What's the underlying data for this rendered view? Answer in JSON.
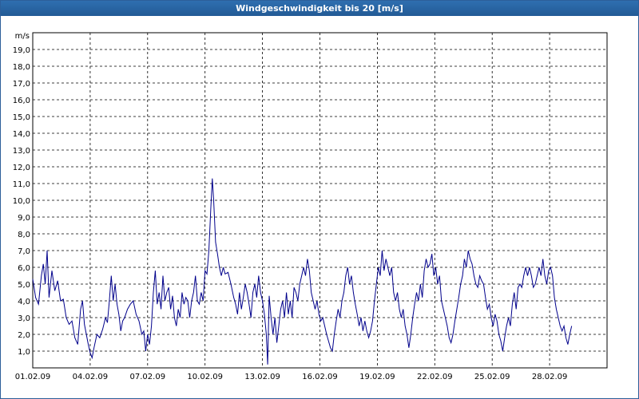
{
  "window": {
    "title": "Windgeschwindigkeit bis 20 [m/s]"
  },
  "chart_data": {
    "type": "line",
    "title": "Windgeschwindigkeit bis 20 [m/s]",
    "ylabel": "m/s",
    "xlabel": "",
    "ylim": [
      0,
      20
    ],
    "xlim_days": [
      0,
      30
    ],
    "grid": true,
    "line_color": "#00008b",
    "y_ticks": [
      "1,0",
      "2,0",
      "3,0",
      "4,0",
      "5,0",
      "6,0",
      "7,0",
      "8,0",
      "9,0",
      "10,0",
      "11,0",
      "12,0",
      "13,0",
      "14,0",
      "15,0",
      "16,0",
      "17,0",
      "18,0",
      "19,0"
    ],
    "x_ticks": [
      {
        "day": 0,
        "label": "01.02.09"
      },
      {
        "day": 3,
        "label": "04.02.09"
      },
      {
        "day": 6,
        "label": "07.02.09"
      },
      {
        "day": 9,
        "label": "10.02.09"
      },
      {
        "day": 12,
        "label": "13.02.09"
      },
      {
        "day": 15,
        "label": "16.02.09"
      },
      {
        "day": 18,
        "label": "19.02.09"
      },
      {
        "day": 21,
        "label": "22.02.09"
      },
      {
        "day": 24,
        "label": "25.02.09"
      },
      {
        "day": 27,
        "label": "28.02.09"
      }
    ],
    "series": [
      {
        "points": [
          [
            0,
            5.3
          ],
          [
            0.15,
            4.2
          ],
          [
            0.3,
            3.8
          ],
          [
            0.45,
            5.5
          ],
          [
            0.55,
            6.2
          ],
          [
            0.65,
            5.0
          ],
          [
            0.75,
            7.0
          ],
          [
            0.85,
            4.2
          ],
          [
            1.0,
            5.8
          ],
          [
            1.15,
            4.6
          ],
          [
            1.3,
            5.2
          ],
          [
            1.45,
            4.0
          ],
          [
            1.6,
            4.1
          ],
          [
            1.75,
            3.0
          ],
          [
            1.9,
            2.6
          ],
          [
            2.05,
            2.8
          ],
          [
            2.2,
            1.8
          ],
          [
            2.35,
            1.4
          ],
          [
            2.5,
            3.5
          ],
          [
            2.6,
            4.0
          ],
          [
            2.7,
            2.6
          ],
          [
            2.8,
            2.0
          ],
          [
            2.9,
            1.4
          ],
          [
            3.0,
            0.9
          ],
          [
            3.1,
            0.6
          ],
          [
            3.2,
            1.2
          ],
          [
            3.35,
            2.0
          ],
          [
            3.5,
            1.8
          ],
          [
            3.65,
            2.3
          ],
          [
            3.8,
            3.0
          ],
          [
            3.9,
            2.7
          ],
          [
            4.0,
            4.0
          ],
          [
            4.1,
            5.5
          ],
          [
            4.2,
            4.0
          ],
          [
            4.3,
            5.0
          ],
          [
            4.4,
            3.8
          ],
          [
            4.5,
            3.2
          ],
          [
            4.6,
            2.2
          ],
          [
            4.7,
            2.8
          ],
          [
            4.8,
            3.0
          ],
          [
            4.95,
            3.5
          ],
          [
            5.1,
            3.8
          ],
          [
            5.25,
            4.0
          ],
          [
            5.4,
            3.2
          ],
          [
            5.55,
            2.8
          ],
          [
            5.7,
            2.0
          ],
          [
            5.8,
            2.2
          ],
          [
            5.9,
            1.0
          ],
          [
            6.0,
            2.0
          ],
          [
            6.1,
            1.4
          ],
          [
            6.2,
            2.5
          ],
          [
            6.3,
            4.5
          ],
          [
            6.4,
            5.8
          ],
          [
            6.5,
            3.8
          ],
          [
            6.6,
            4.5
          ],
          [
            6.7,
            3.5
          ],
          [
            6.8,
            5.5
          ],
          [
            6.9,
            4.0
          ],
          [
            7.0,
            4.5
          ],
          [
            7.1,
            4.8
          ],
          [
            7.2,
            3.5
          ],
          [
            7.3,
            4.3
          ],
          [
            7.4,
            3.0
          ],
          [
            7.5,
            2.5
          ],
          [
            7.6,
            3.5
          ],
          [
            7.7,
            3.0
          ],
          [
            7.8,
            4.5
          ],
          [
            7.9,
            3.8
          ],
          [
            8.0,
            4.2
          ],
          [
            8.1,
            4.0
          ],
          [
            8.2,
            3.0
          ],
          [
            8.3,
            4.0
          ],
          [
            8.4,
            4.5
          ],
          [
            8.5,
            5.5
          ],
          [
            8.6,
            4.0
          ],
          [
            8.7,
            3.8
          ],
          [
            8.8,
            4.5
          ],
          [
            8.9,
            4.0
          ],
          [
            9.0,
            5.8
          ],
          [
            9.1,
            5.6
          ],
          [
            9.2,
            7.0
          ],
          [
            9.3,
            9.5
          ],
          [
            9.38,
            11.3
          ],
          [
            9.45,
            10.0
          ],
          [
            9.55,
            7.5
          ],
          [
            9.65,
            6.8
          ],
          [
            9.75,
            6.0
          ],
          [
            9.85,
            5.5
          ],
          [
            9.95,
            6.0
          ],
          [
            10.05,
            5.6
          ],
          [
            10.2,
            5.7
          ],
          [
            10.35,
            5.0
          ],
          [
            10.5,
            4.2
          ],
          [
            10.6,
            3.8
          ],
          [
            10.7,
            3.2
          ],
          [
            10.8,
            4.5
          ],
          [
            10.9,
            3.5
          ],
          [
            11.0,
            4.2
          ],
          [
            11.1,
            5.0
          ],
          [
            11.2,
            4.5
          ],
          [
            11.3,
            3.8
          ],
          [
            11.4,
            3.0
          ],
          [
            11.5,
            4.5
          ],
          [
            11.6,
            5.0
          ],
          [
            11.7,
            4.2
          ],
          [
            11.8,
            5.5
          ],
          [
            11.9,
            4.5
          ],
          [
            12.0,
            4.0
          ],
          [
            12.1,
            3.2
          ],
          [
            12.2,
            2.0
          ],
          [
            12.27,
            0.2
          ],
          [
            12.35,
            4.3
          ],
          [
            12.45,
            3.0
          ],
          [
            12.55,
            2.0
          ],
          [
            12.65,
            3.0
          ],
          [
            12.75,
            1.5
          ],
          [
            12.85,
            2.5
          ],
          [
            12.95,
            3.5
          ],
          [
            13.05,
            4.0
          ],
          [
            13.15,
            3.0
          ],
          [
            13.25,
            4.5
          ],
          [
            13.35,
            3.2
          ],
          [
            13.45,
            4.0
          ],
          [
            13.55,
            3.0
          ],
          [
            13.65,
            4.8
          ],
          [
            13.75,
            4.5
          ],
          [
            13.85,
            4.0
          ],
          [
            13.95,
            5.0
          ],
          [
            14.05,
            5.5
          ],
          [
            14.15,
            6.0
          ],
          [
            14.25,
            5.5
          ],
          [
            14.35,
            6.5
          ],
          [
            14.45,
            5.8
          ],
          [
            14.55,
            4.5
          ],
          [
            14.65,
            4.0
          ],
          [
            14.75,
            3.5
          ],
          [
            14.85,
            4.0
          ],
          [
            14.95,
            3.2
          ],
          [
            15.05,
            2.8
          ],
          [
            15.15,
            3.0
          ],
          [
            15.25,
            2.5
          ],
          [
            15.35,
            2.0
          ],
          [
            15.45,
            1.6
          ],
          [
            15.55,
            1.2
          ],
          [
            15.65,
            1.0
          ],
          [
            15.75,
            2.0
          ],
          [
            15.85,
            2.8
          ],
          [
            15.95,
            3.5
          ],
          [
            16.05,
            3.0
          ],
          [
            16.15,
            4.0
          ],
          [
            16.25,
            4.5
          ],
          [
            16.35,
            5.5
          ],
          [
            16.45,
            6.0
          ],
          [
            16.55,
            5.0
          ],
          [
            16.65,
            5.5
          ],
          [
            16.75,
            4.5
          ],
          [
            16.85,
            3.8
          ],
          [
            16.95,
            3.2
          ],
          [
            17.05,
            2.5
          ],
          [
            17.15,
            3.0
          ],
          [
            17.25,
            2.2
          ],
          [
            17.35,
            2.8
          ],
          [
            17.45,
            2.2
          ],
          [
            17.55,
            1.8
          ],
          [
            17.65,
            2.2
          ],
          [
            17.75,
            2.8
          ],
          [
            17.85,
            4.0
          ],
          [
            17.95,
            5.0
          ],
          [
            18.05,
            6.0
          ],
          [
            18.15,
            5.5
          ],
          [
            18.25,
            7.0
          ],
          [
            18.35,
            5.8
          ],
          [
            18.45,
            6.5
          ],
          [
            18.55,
            6.0
          ],
          [
            18.65,
            5.5
          ],
          [
            18.75,
            6.0
          ],
          [
            18.85,
            4.5
          ],
          [
            18.95,
            4.0
          ],
          [
            19.05,
            4.5
          ],
          [
            19.15,
            3.5
          ],
          [
            19.25,
            3.0
          ],
          [
            19.35,
            3.5
          ],
          [
            19.45,
            2.5
          ],
          [
            19.55,
            2.0
          ],
          [
            19.65,
            1.2
          ],
          [
            19.75,
            2.0
          ],
          [
            19.85,
            3.0
          ],
          [
            19.95,
            3.8
          ],
          [
            20.05,
            4.5
          ],
          [
            20.15,
            4.0
          ],
          [
            20.25,
            5.0
          ],
          [
            20.35,
            4.2
          ],
          [
            20.45,
            5.8
          ],
          [
            20.55,
            6.5
          ],
          [
            20.65,
            6.0
          ],
          [
            20.75,
            6.2
          ],
          [
            20.85,
            6.8
          ],
          [
            20.95,
            5.5
          ],
          [
            21.05,
            6.0
          ],
          [
            21.15,
            5.0
          ],
          [
            21.25,
            5.5
          ],
          [
            21.35,
            4.0
          ],
          [
            21.45,
            3.5
          ],
          [
            21.55,
            3.0
          ],
          [
            21.65,
            2.5
          ],
          [
            21.75,
            1.8
          ],
          [
            21.85,
            1.5
          ],
          [
            21.95,
            2.0
          ],
          [
            22.05,
            2.8
          ],
          [
            22.15,
            3.5
          ],
          [
            22.25,
            4.2
          ],
          [
            22.35,
            5.0
          ],
          [
            22.45,
            5.5
          ],
          [
            22.55,
            6.5
          ],
          [
            22.65,
            6.0
          ],
          [
            22.75,
            7.0
          ],
          [
            22.85,
            6.5
          ],
          [
            22.95,
            6.2
          ],
          [
            23.05,
            5.5
          ],
          [
            23.15,
            5.0
          ],
          [
            23.25,
            4.8
          ],
          [
            23.35,
            5.5
          ],
          [
            23.45,
            5.2
          ],
          [
            23.55,
            5.0
          ],
          [
            23.65,
            4.2
          ],
          [
            23.75,
            3.5
          ],
          [
            23.85,
            3.8
          ],
          [
            23.95,
            3.0
          ],
          [
            24.05,
            2.5
          ],
          [
            24.15,
            3.2
          ],
          [
            24.25,
            2.8
          ],
          [
            24.35,
            2.0
          ],
          [
            24.45,
            1.6
          ],
          [
            24.55,
            1.0
          ],
          [
            24.65,
            1.8
          ],
          [
            24.75,
            2.5
          ],
          [
            24.85,
            3.0
          ],
          [
            24.95,
            2.5
          ],
          [
            25.05,
            3.8
          ],
          [
            25.15,
            4.5
          ],
          [
            25.25,
            3.5
          ],
          [
            25.35,
            4.8
          ],
          [
            25.45,
            5.0
          ],
          [
            25.55,
            4.8
          ],
          [
            25.65,
            5.5
          ],
          [
            25.75,
            6.0
          ],
          [
            25.85,
            5.5
          ],
          [
            25.95,
            6.0
          ],
          [
            26.05,
            5.5
          ],
          [
            26.15,
            4.8
          ],
          [
            26.25,
            5.0
          ],
          [
            26.35,
            5.5
          ],
          [
            26.45,
            6.0
          ],
          [
            26.55,
            5.5
          ],
          [
            26.65,
            6.5
          ],
          [
            26.75,
            5.5
          ],
          [
            26.85,
            5.0
          ],
          [
            26.95,
            5.8
          ],
          [
            27.05,
            6.0
          ],
          [
            27.15,
            5.5
          ],
          [
            27.25,
            4.2
          ],
          [
            27.35,
            3.5
          ],
          [
            27.45,
            3.0
          ],
          [
            27.55,
            2.5
          ],
          [
            27.65,
            2.2
          ],
          [
            27.75,
            2.5
          ],
          [
            27.85,
            1.8
          ],
          [
            27.95,
            1.4
          ],
          [
            28.05,
            2.0
          ],
          [
            28.15,
            2.5
          ]
        ]
      }
    ]
  }
}
